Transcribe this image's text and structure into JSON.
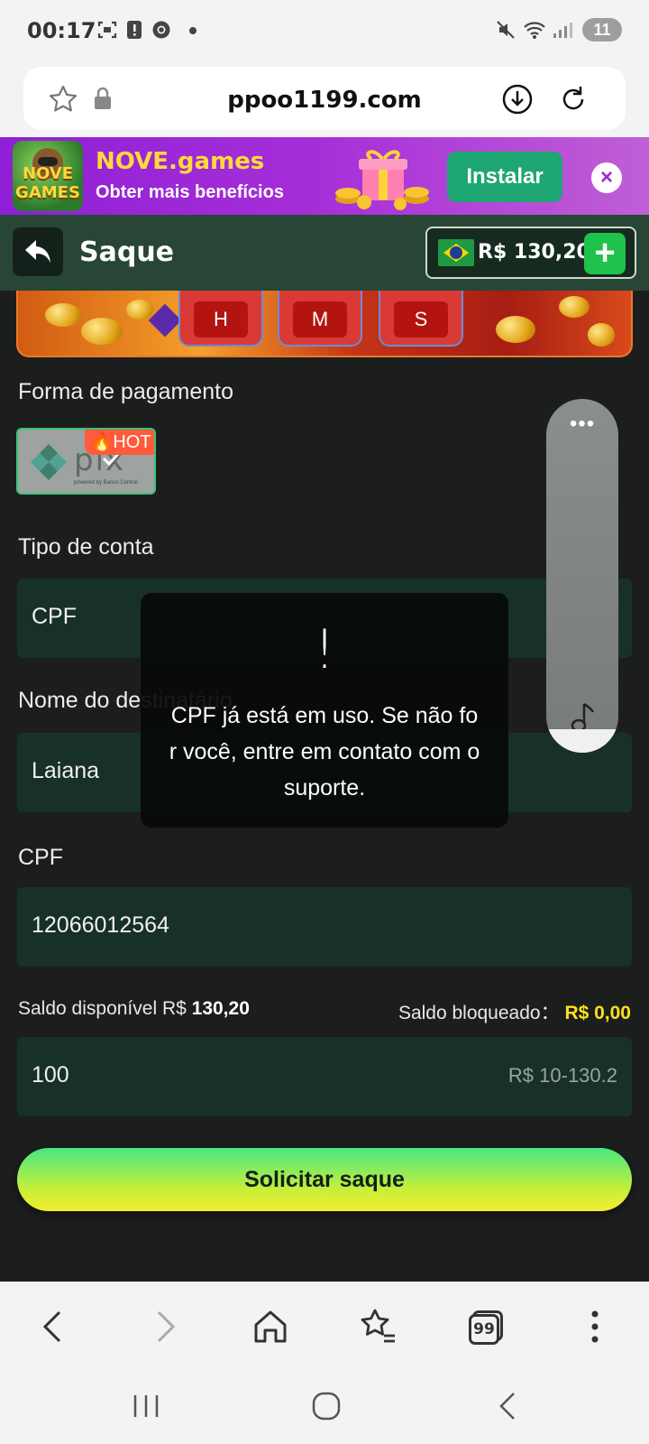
{
  "status_bar": {
    "time": "00:17",
    "battery": "11",
    "icons": [
      "screenshot-icon",
      "alert-icon",
      "chrome-icon",
      "mute-icon",
      "wifi-icon",
      "signal-icon"
    ]
  },
  "browser": {
    "url": "ppoo1199.com",
    "icons": [
      "star-icon",
      "lock-icon",
      "download-icon",
      "reload-icon"
    ]
  },
  "banner": {
    "app_name": "NOVE.games",
    "subtitle": "Obter mais benefícios",
    "install_label": "Instalar",
    "logo_text": "NOVE GAMES",
    "close_symbol": "×"
  },
  "header": {
    "title": "Saque",
    "balance": "R$ 130,20",
    "plus_symbol": "+"
  },
  "promo": {
    "timers": [
      "H",
      "M",
      "S"
    ]
  },
  "form": {
    "payment_label": "Forma de pagamento",
    "pix_word": "pix",
    "pix_caption": "powered by Banco Central",
    "hot_badge": "HOT",
    "account_type_label": "Tipo de conta",
    "account_type_value": "CPF",
    "recipient_label": "Nome do destinatário",
    "recipient_value": "Laiana",
    "cpf_label": "CPF",
    "cpf_value": "12066012564",
    "saldo_disponivel_label": "Saldo disponível R$",
    "saldo_disponivel_value": "130,20",
    "saldo_bloqueado_label": "Saldo bloqueado：",
    "saldo_bloqueado_value": "R$ 0,00",
    "amount_value": "100",
    "amount_hint": "R$ 10-130.2",
    "submit_label": "Solicitar saque"
  },
  "toast": {
    "icon": "!",
    "message": "CPF já está em uso. Se não for você, entre em contato com o suporte."
  },
  "music_widget": {
    "menu": "•••"
  },
  "bottom_toolbar": {
    "tab_count": "99",
    "icons": [
      "back-icon",
      "forward-icon",
      "home-icon",
      "bookmarks-icon",
      "tabs-icon",
      "menu-icon"
    ]
  },
  "nav_bar": {
    "icons": [
      "recent-apps-icon",
      "home-nav-icon",
      "back-nav-icon"
    ]
  },
  "colors": {
    "background": "#1b1e1d",
    "header": "#284635",
    "field": "#183126",
    "accent_green": "#1fc24a",
    "banner_purple": "#a72fd8",
    "yellow": "#ffe01b"
  }
}
